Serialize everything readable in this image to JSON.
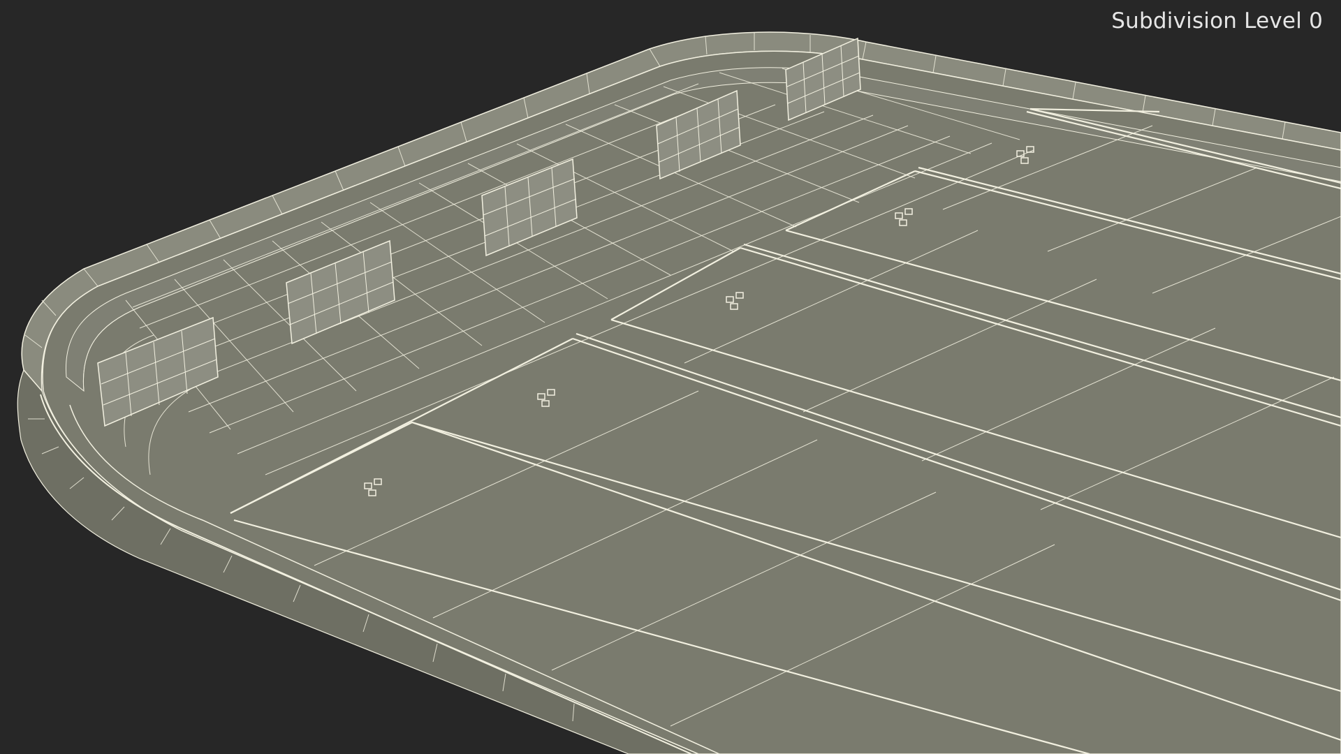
{
  "viewport": {
    "subdivision_label": "Subdivision Level 0",
    "background_color": "#272727",
    "surface_color": "#7a7b6e",
    "wire_color": "#f2f0e0"
  }
}
